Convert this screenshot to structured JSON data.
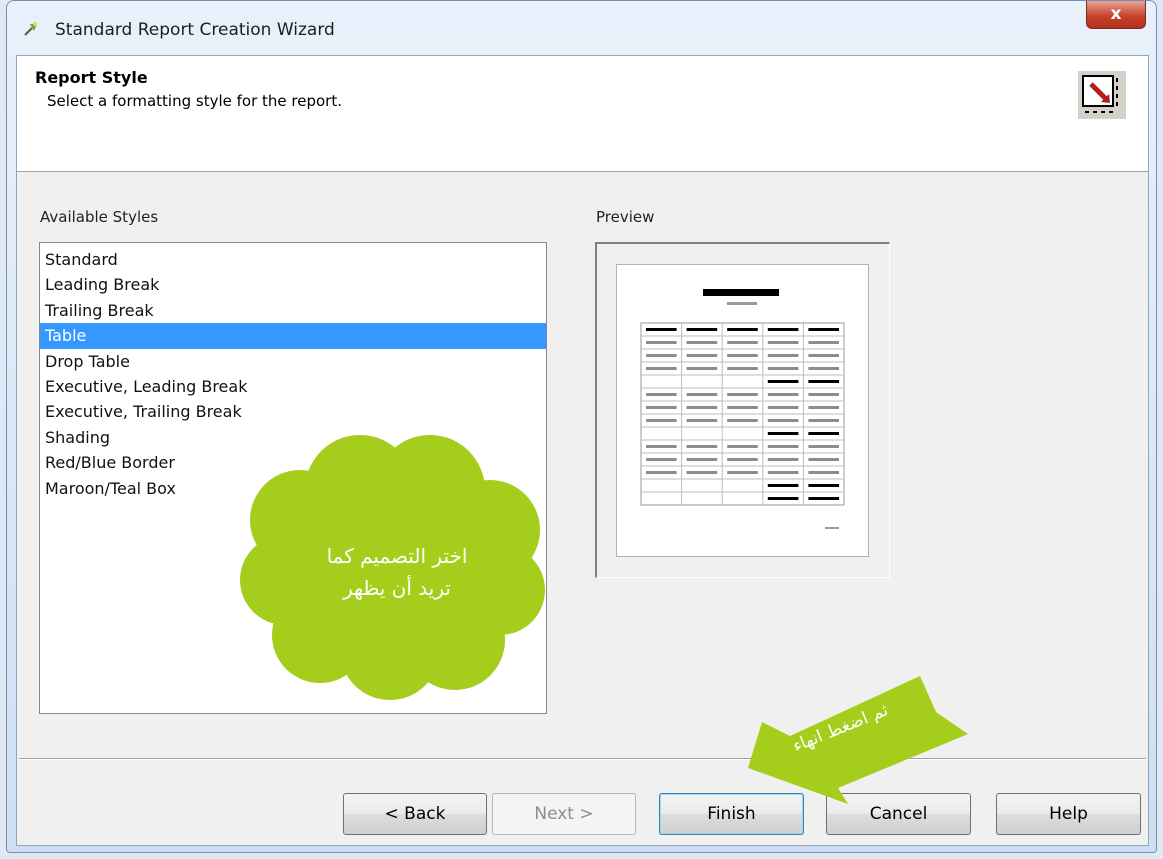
{
  "window": {
    "title": "Standard Report Creation Wizard",
    "close_label": "x"
  },
  "header": {
    "title": "Report Style",
    "subtitle": "Select a formatting style for the report."
  },
  "styles": {
    "label": "Available Styles",
    "items": [
      "Standard",
      "Leading Break",
      "Trailing Break",
      "Table",
      "Drop Table",
      "Executive, Leading Break",
      "Executive, Trailing Break",
      "Shading",
      "Red/Blue Border",
      "Maroon/Teal Box"
    ],
    "selected": "Table"
  },
  "preview": {
    "label": "Preview"
  },
  "buttons": {
    "back": "< Back",
    "next": "Next >",
    "finish": "Finish",
    "cancel": "Cancel",
    "help": "Help"
  },
  "annotations": {
    "cloud_line1": "اختر التصميم كما",
    "cloud_line2": "تريد أن يظهر",
    "arrow_text": "ثم اضغط انهاء"
  },
  "colors": {
    "selection": "#3399ff",
    "annotation_green": "#a5cd1c"
  }
}
